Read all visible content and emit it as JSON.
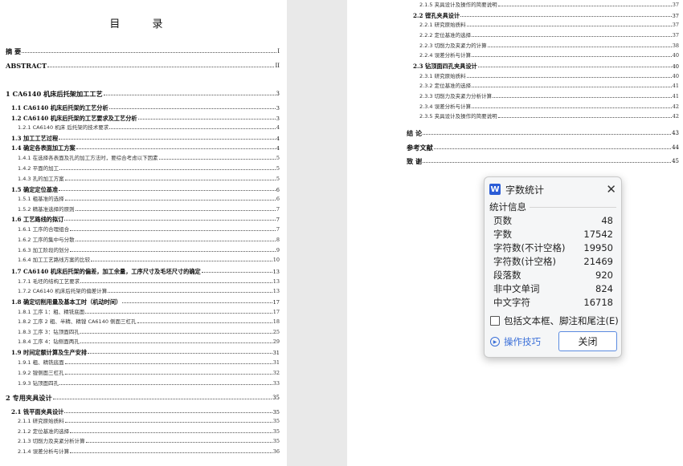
{
  "left_page": {
    "title": "目  录",
    "entries": [
      {
        "level": 0,
        "text": "摘 要",
        "page": "I"
      },
      {
        "level": 0,
        "text": "ABSTRACT",
        "page": "II"
      },
      {
        "level": 0,
        "text": "1 CA6140 机床后托架加工工艺",
        "page": "3"
      },
      {
        "level": 1,
        "text": "1.1 CA6140 机床后托架的工艺分析",
        "page": "3"
      },
      {
        "level": 1,
        "text": "1.2 CA6140 机床后托架的工艺要求及工艺分析",
        "page": "3"
      },
      {
        "level": 2,
        "text": "1.2.1 CA6140 机床 后托架的技术要求",
        "page": "4"
      },
      {
        "level": 1,
        "text": "1.3 加工工艺过程",
        "page": "4"
      },
      {
        "level": 1,
        "text": "1.4 确定各表面加工方案",
        "page": "4"
      },
      {
        "level": 2,
        "text": "1.4.1 在选择各表面及孔的加工方法时，要综合考虑以下因素",
        "page": "5"
      },
      {
        "level": 2,
        "text": "1.4.2 平面的加工",
        "page": "5"
      },
      {
        "level": 2,
        "text": "1.4.3 孔的加工方案",
        "page": "5"
      },
      {
        "level": 1,
        "text": "1.5 确定定位基准",
        "page": "6"
      },
      {
        "level": 2,
        "text": "1.5.1 粗基准的选择",
        "page": "6"
      },
      {
        "level": 2,
        "text": "1.5.2 精基准选择的原则",
        "page": "7"
      },
      {
        "level": 1,
        "text": "1.6 工艺路线的拟订",
        "page": "7"
      },
      {
        "level": 2,
        "text": "1.6.1 工序的合理组合",
        "page": "7"
      },
      {
        "level": 2,
        "text": "1.6.2 工序的集中与分散",
        "page": "8"
      },
      {
        "level": 2,
        "text": "1.6.3 加工阶段的划分",
        "page": "9"
      },
      {
        "level": 2,
        "text": "1.6.4 加工工艺路线方案的比较",
        "page": "10"
      },
      {
        "level": 1,
        "text": "1.7 CA6140 机床后托架的偏差，加工余量，工序尺寸及毛坯尺寸的确定",
        "page": "13"
      },
      {
        "level": 2,
        "text": "1.7.1 毛坯的结构工艺要求",
        "page": "13"
      },
      {
        "level": 2,
        "text": "1.7.2 CA6140 机床后托架的偏差计算",
        "page": "13"
      },
      {
        "level": 1,
        "text": "1.8 确定切削用量及基本工时（机动时间）",
        "page": "17"
      },
      {
        "level": 2,
        "text": "1.8.1 工序 1：粗、精铣底面",
        "page": "17"
      },
      {
        "level": 2,
        "text": "1.8.2 工序 2 粗、半精、精镗 CA6140 侧面三杠孔",
        "page": "18"
      },
      {
        "level": 2,
        "text": "1.8.3 工序 3：钻顶面四孔",
        "page": "25"
      },
      {
        "level": 2,
        "text": "1.8.4 工序 4：钻侧面两孔",
        "page": "29"
      },
      {
        "level": 1,
        "text": "1.9 时间定额计算及生产安排",
        "page": "31"
      },
      {
        "level": 2,
        "text": "1.9.1 粗、精铣底面",
        "page": "31"
      },
      {
        "level": 2,
        "text": "1.9.2 镗侧面三杠孔",
        "page": "32"
      },
      {
        "level": 2,
        "text": "1.9.3 钻顶面四孔",
        "page": "33"
      },
      {
        "level": 0,
        "text": "2 专用夹具设计",
        "page": "35"
      },
      {
        "level": 1,
        "text": "2.1 铣平面夹具设计",
        "page": "35"
      },
      {
        "level": 2,
        "text": "2.1.1 研究原始质料",
        "page": "35"
      },
      {
        "level": 2,
        "text": "2.1.2 定位基准的选择",
        "page": "35"
      },
      {
        "level": 2,
        "text": "2.1.3 切削力及夹紧分析计算",
        "page": "35"
      },
      {
        "level": 2,
        "text": "2.1.4 误差分析与计算",
        "page": "36"
      }
    ]
  },
  "right_page": {
    "entries": [
      {
        "level": 2,
        "text": "2.1.5 夹具设计及操作的简要说明",
        "page": "37"
      },
      {
        "level": 1,
        "text": "2.2 镗孔夹具设计",
        "page": "37"
      },
      {
        "level": 2,
        "text": "2.2.1 研究原始质料",
        "page": "37"
      },
      {
        "level": 2,
        "text": "2.2.2 定位基准的选择",
        "page": "37"
      },
      {
        "level": 2,
        "text": "2.2.3 切削力及夹紧力的计算",
        "page": "38"
      },
      {
        "level": 2,
        "text": "2.2.4 误差分析与计算",
        "page": "40"
      },
      {
        "level": 1,
        "text": "2.3 钻顶面四孔夹具设计",
        "page": "40"
      },
      {
        "level": 2,
        "text": "2.3.1 研究原始质料",
        "page": "40"
      },
      {
        "level": 2,
        "text": "2.3.2 定位基准的选择",
        "page": "41"
      },
      {
        "level": 2,
        "text": "2.3.3 切削力及夹紧力分析计算",
        "page": "41"
      },
      {
        "level": 2,
        "text": "2.3.4 误差分析与计算",
        "page": "42"
      },
      {
        "level": 2,
        "text": "2.3.5 夹具设计及操作的简要说明",
        "page": "42"
      },
      {
        "level": 0,
        "text": "结 论",
        "page": "43"
      },
      {
        "level": 0,
        "text": "参考文献",
        "page": "44"
      },
      {
        "level": 0,
        "text": "致 谢",
        "page": "45"
      }
    ]
  },
  "dialog": {
    "logo": "W",
    "title": "字数统计",
    "section": "统计信息",
    "stats": [
      {
        "label": "页数",
        "value": "48"
      },
      {
        "label": "字数",
        "value": "17542"
      },
      {
        "label": "字符数(不计空格)",
        "value": "19950"
      },
      {
        "label": "字符数(计空格)",
        "value": "21469"
      },
      {
        "label": "段落数",
        "value": "920"
      },
      {
        "label": "非中文单词",
        "value": "824"
      },
      {
        "label": "中文字符",
        "value": "16718"
      }
    ],
    "checkbox_label": "包括文本框、脚注和尾注(E)",
    "tips_label": "操作技巧",
    "close_label": "关闭",
    "accent": "#2b5cd6"
  }
}
